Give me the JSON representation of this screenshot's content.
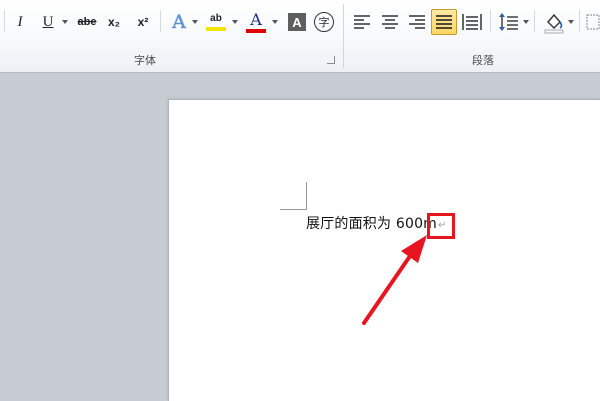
{
  "ribbon": {
    "font_group": {
      "label": "字体",
      "buttons": {
        "italic": "I",
        "underline": "U",
        "strikethrough": "abe",
        "subscript": "x₂",
        "superscript": "x²",
        "text_effects": "A",
        "highlight": "ab",
        "font_color": "A",
        "char_shading": "A",
        "enclose_char": "字"
      }
    },
    "paragraph_group": {
      "label": "段落"
    },
    "colors": {
      "highlight_bar": "#f2e600",
      "font_color_bar": "#e00000",
      "active_button": "#fbd664"
    }
  },
  "document": {
    "text": "展厅的面积为 600m",
    "paragraph_mark": "↵",
    "annotation_color": "#e8141f"
  }
}
